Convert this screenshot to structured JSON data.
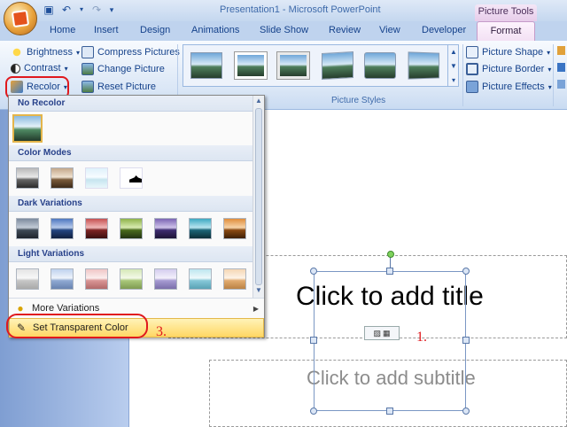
{
  "window": {
    "title": "Presentation1 - Microsoft PowerPoint",
    "context_tools": "Picture Tools"
  },
  "tabs": [
    "Home",
    "Insert",
    "Design",
    "Animations",
    "Slide Show",
    "Review",
    "View",
    "Developer",
    "Format"
  ],
  "ribbon": {
    "adjust": {
      "brightness": "Brightness",
      "contrast": "Contrast",
      "recolor": "Recolor",
      "compress": "Compress Pictures",
      "change": "Change Picture",
      "reset": "Reset Picture"
    },
    "picture_styles_label": "Picture Styles",
    "picture_shape": "Picture Shape",
    "picture_border": "Picture Border",
    "picture_effects": "Picture Effects"
  },
  "menu": {
    "no_recolor": "No Recolor",
    "color_modes": "Color Modes",
    "dark_variations": "Dark Variations",
    "light_variations": "Light Variations",
    "more_variations": "More Variations",
    "set_transparent": "Set Transparent Color"
  },
  "slide": {
    "title_placeholder": "Click to add title",
    "subtitle_placeholder": "Click to add subtitle"
  },
  "annotations": {
    "one": "1.",
    "two": "2.",
    "three": "3."
  }
}
